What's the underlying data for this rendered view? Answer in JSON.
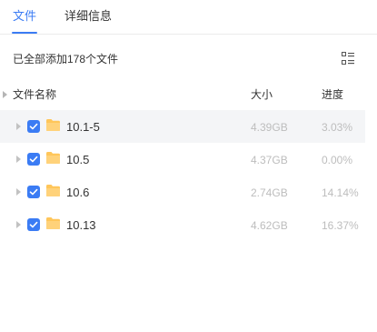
{
  "tabs": [
    {
      "label": "文件"
    },
    {
      "label": "详细信息"
    }
  ],
  "summary": "已全部添加178个文件",
  "header": {
    "name": "文件名称",
    "size": "大小",
    "progress": "进度"
  },
  "colors": {
    "accent": "#3b7cf4",
    "folder": "#ffc65a",
    "muted": "#bdbdbd"
  },
  "files": [
    {
      "name": "10.1-5",
      "size": "4.39GB",
      "progress": "3.03%",
      "checked": true
    },
    {
      "name": "10.5",
      "size": "4.37GB",
      "progress": "0.00%",
      "checked": true
    },
    {
      "name": "10.6",
      "size": "2.74GB",
      "progress": "14.14%",
      "checked": true
    },
    {
      "name": "10.13",
      "size": "4.62GB",
      "progress": "16.37%",
      "checked": true
    }
  ]
}
